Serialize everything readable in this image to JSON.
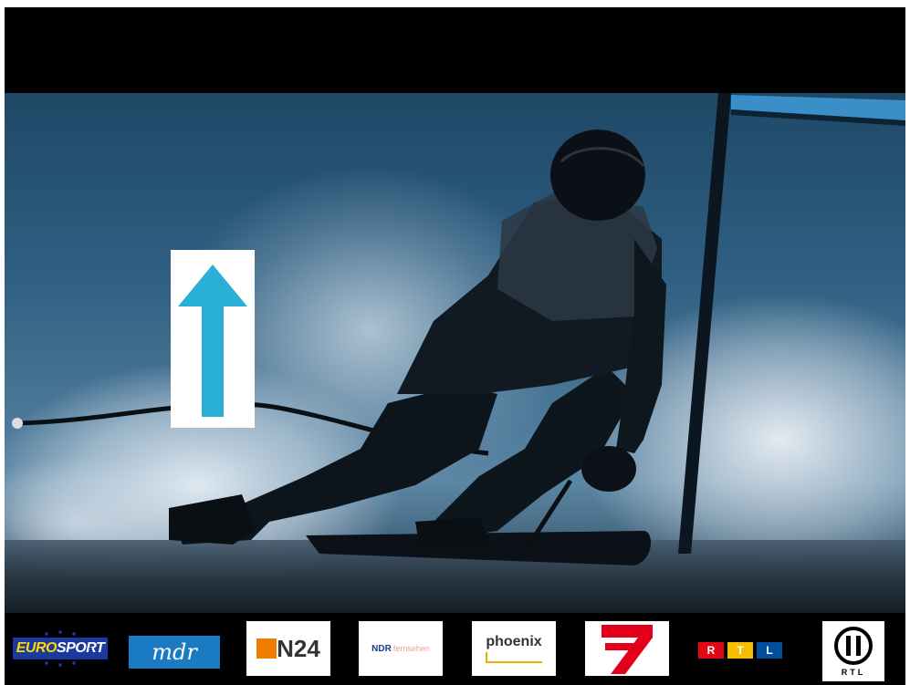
{
  "channels": {
    "eurosport": {
      "label_part1": "EURO",
      "label_part2": "SPORT"
    },
    "mdr": {
      "label": "mdr"
    },
    "n24": {
      "label": "N24"
    },
    "ndr": {
      "label": "NDR",
      "sub": "fernsehen"
    },
    "phoenix": {
      "label": "phoenix"
    },
    "pro7": {
      "label": "7"
    },
    "rtl": {
      "letters": [
        "R",
        "T",
        "L"
      ]
    },
    "rtl2": {
      "label": "RTL"
    }
  },
  "colors": {
    "arrow": "#2ab0d6",
    "eurosport_blue": "#1b3aa0",
    "mdr_blue": "#1a7bc2",
    "n24_orange": "#f07c00",
    "pro7_red": "#e3001b",
    "rtl_red": "#e30613",
    "rtl_yellow": "#f6c000",
    "rtl_blue": "#00509f"
  },
  "icons": {
    "arrow_card": "up-arrow-icon",
    "eurosport_stars": "star-ring-icon",
    "rtl2_emblem": "circle-ii-icon"
  }
}
